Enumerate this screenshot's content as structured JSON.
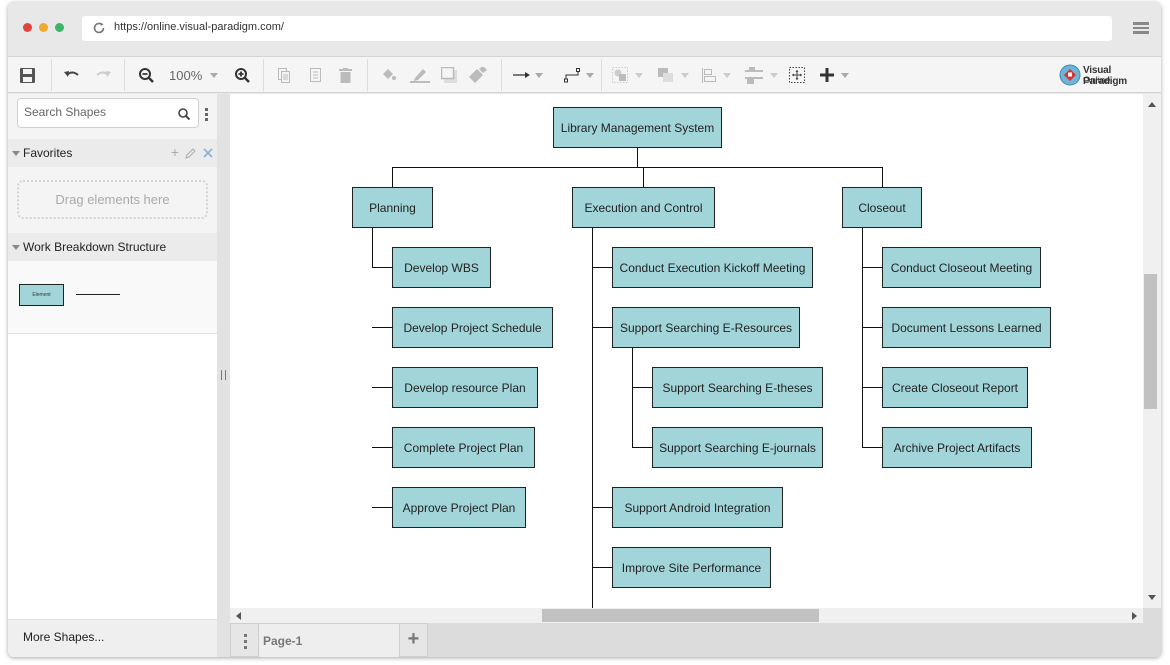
{
  "browser": {
    "url": "https://online.visual-paradigm.com/",
    "traffic_lights": {
      "close": "#e0443e",
      "minimize": "#f0a92b",
      "maximize": "#3cb46a"
    }
  },
  "toolbar": {
    "zoom_level": "100%",
    "logo_line1": "Visual Paradigm",
    "logo_line2": "Online",
    "icons": [
      "save-icon",
      "undo-icon",
      "redo-icon",
      "zoom-out-icon",
      "zoom-in-icon",
      "copy-icon",
      "paste-icon",
      "delete-icon",
      "fill-color-icon",
      "line-color-icon",
      "shadow-icon",
      "format-painter-icon",
      "connector-icon",
      "waypoint-style-icon",
      "group-icon",
      "arrange-icon",
      "align-icon",
      "distribute-icon",
      "fit-selection-icon",
      "add-icon"
    ]
  },
  "sidebar": {
    "search_placeholder": "Search Shapes",
    "favorites_label": "Favorites",
    "dropzone_text": "Drag elements here",
    "wbs_section_label": "Work Breakdown Structure",
    "element_shape_label": "Element",
    "more_shapes": "More Shapes..."
  },
  "pages": {
    "current": "Page-1",
    "add_label": "+"
  },
  "diagram": {
    "fill_color": "#a2d5d9",
    "root": "Library Management System",
    "branches": [
      {
        "label": "Planning",
        "children": [
          {
            "label": "Develop WBS"
          },
          {
            "label": "Develop Project Schedule"
          },
          {
            "label": "Develop resource Plan"
          },
          {
            "label": "Complete Project Plan"
          },
          {
            "label": "Approve Project Plan"
          }
        ]
      },
      {
        "label": "Execution and Control",
        "children": [
          {
            "label": "Conduct Execution Kickoff Meeting"
          },
          {
            "label": "Support Searching E-Resources",
            "children": [
              {
                "label": "Support Searching E-theses"
              },
              {
                "label": "Support Searching E-journals"
              }
            ]
          },
          {
            "label": "Support Android Integration"
          },
          {
            "label": "Improve Site Performance"
          }
        ]
      },
      {
        "label": "Closeout",
        "children": [
          {
            "label": "Conduct Closeout Meeting"
          },
          {
            "label": "Document Lessons Learned"
          },
          {
            "label": "Create Closeout Report"
          },
          {
            "label": "Archive Project Artifacts"
          }
        ]
      }
    ]
  }
}
